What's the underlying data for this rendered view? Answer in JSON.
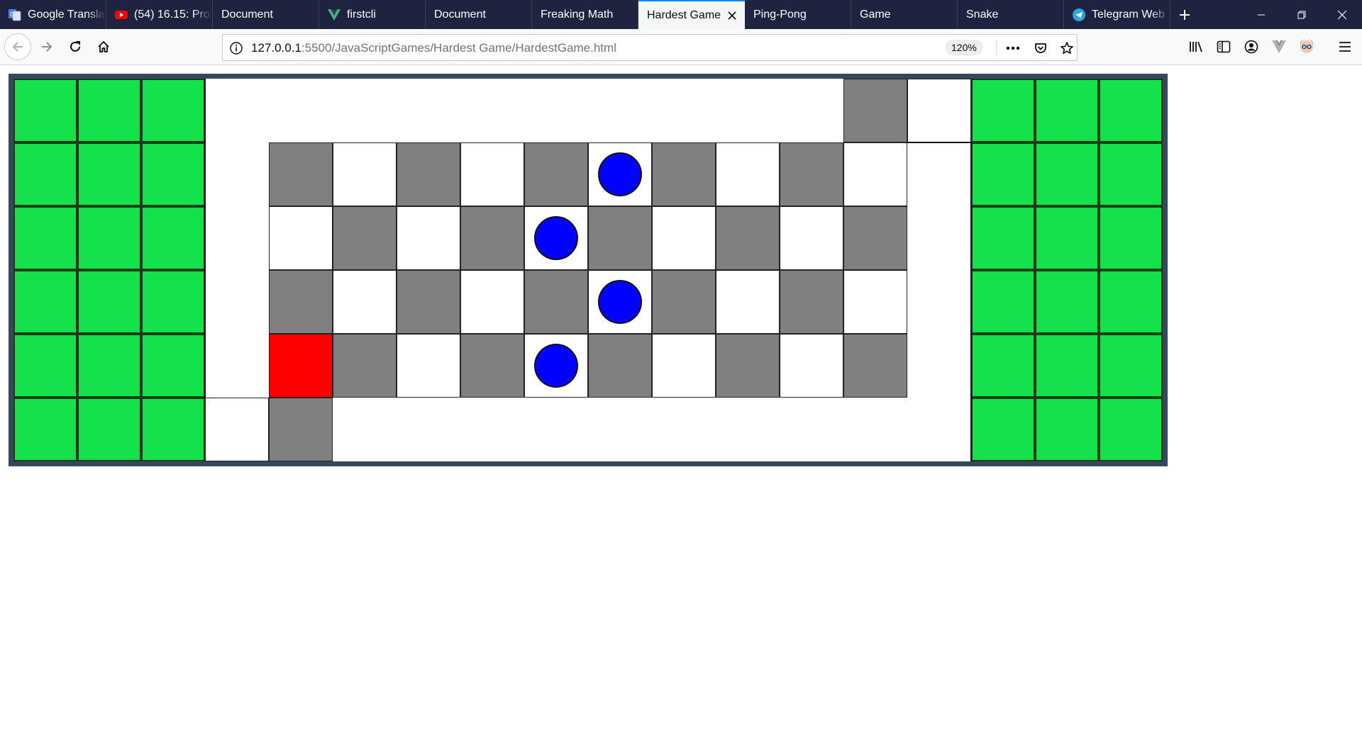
{
  "browser": {
    "tabs": [
      {
        "label": "Google Transla",
        "icon": "google-translate-icon",
        "active": false
      },
      {
        "label": "(54) 16.15: Pro",
        "icon": "youtube-icon",
        "active": false
      },
      {
        "label": "Document",
        "icon": "",
        "active": false
      },
      {
        "label": "firstcli",
        "icon": "vue-icon",
        "active": false
      },
      {
        "label": "Document",
        "icon": "",
        "active": false
      },
      {
        "label": "Freaking Math",
        "icon": "",
        "active": false
      },
      {
        "label": "Hardest Game",
        "icon": "",
        "active": true
      },
      {
        "label": "Ping-Pong",
        "icon": "",
        "active": false
      },
      {
        "label": "Game",
        "icon": "",
        "active": false
      },
      {
        "label": "Snake",
        "icon": "",
        "active": false
      },
      {
        "label": "Telegram Web",
        "icon": "telegram-icon",
        "active": false
      }
    ],
    "url": {
      "host": "127.0.0.1",
      "rest": ":5500/JavaScriptGames/Hardest Game/HardestGame.html"
    },
    "zoom": "120%"
  },
  "colors": {
    "tab_bar": "#202340",
    "board_frame": "#34495e",
    "safe_zone": "#15e24a",
    "tile_dark": "#808080",
    "tile_light": "#ffffff",
    "player": "#ff0000",
    "enemy": "#0000ff"
  },
  "game": {
    "title": "Hardest Game",
    "grid": {
      "columns": 18,
      "rows": 6
    },
    "player": {
      "col": 4,
      "row": 4
    },
    "enemies": [
      {
        "col": 9,
        "row": 1
      },
      {
        "col": 8,
        "row": 2
      },
      {
        "col": 9,
        "row": 3
      },
      {
        "col": 8,
        "row": 4
      }
    ]
  }
}
